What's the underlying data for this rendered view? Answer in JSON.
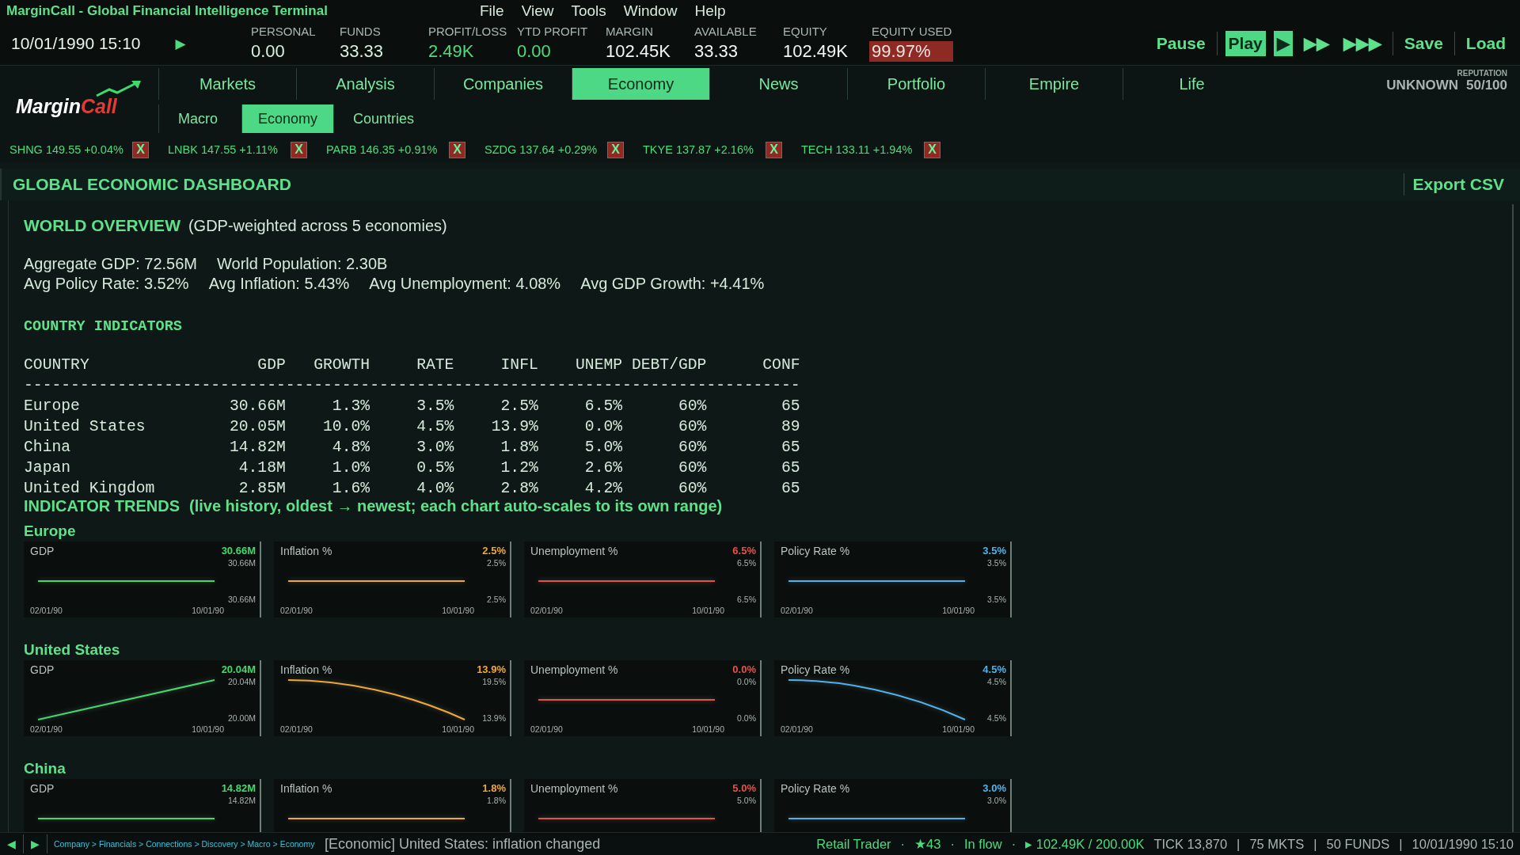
{
  "window": {
    "title": "MarginCall - Global Financial Intelligence Terminal"
  },
  "menu": [
    "File",
    "View",
    "Tools",
    "Window",
    "Help"
  ],
  "toolbar": {
    "datetime": "10/01/1990 15:10",
    "run_button": "▶",
    "stats": [
      {
        "label": "PERSONAL",
        "value": "0.00",
        "kind": "plain",
        "alert": false
      },
      {
        "label": "FUNDS",
        "value": "33.33",
        "kind": "plain",
        "alert": false
      },
      {
        "label": "PROFIT/LOSS",
        "value": "2.49K",
        "kind": "positive",
        "alert": false
      },
      {
        "label": "YTD PROFIT",
        "value": "0.00",
        "kind": "positive",
        "alert": false
      },
      {
        "label": "MARGIN",
        "value": "102.45K",
        "kind": "bright",
        "alert": false
      },
      {
        "label": "AVAILABLE",
        "value": "33.33",
        "kind": "bright",
        "alert": false
      },
      {
        "label": "EQUITY",
        "value": "102.49K",
        "kind": "bright",
        "alert": false
      },
      {
        "label": "EQUITY USED",
        "value": "99.97%",
        "kind": "bright",
        "alert": true
      }
    ],
    "controls": [
      {
        "label": "Pause",
        "selected": false
      },
      {
        "label": "Play",
        "selected": true
      },
      {
        "label": "▶",
        "selected": true
      },
      {
        "label": "▶▶",
        "selected": false
      },
      {
        "label": "▶▶▶",
        "selected": false
      },
      {
        "label": "Save",
        "selected": false
      },
      {
        "label": "Load",
        "selected": false
      }
    ]
  },
  "logo": {
    "text_1": "Margin",
    "text_2": "Call"
  },
  "nav": {
    "tabs": [
      {
        "label": "Markets",
        "selected": false
      },
      {
        "label": "Analysis",
        "selected": false
      },
      {
        "label": "Companies",
        "selected": false
      },
      {
        "label": "Economy",
        "selected": true
      },
      {
        "label": "News",
        "selected": false
      },
      {
        "label": "Portfolio",
        "selected": false
      },
      {
        "label": "Empire",
        "selected": false
      },
      {
        "label": "Life",
        "selected": false
      }
    ],
    "subtabs": [
      {
        "label": "Macro",
        "selected": false
      },
      {
        "label": "Economy",
        "selected": true
      },
      {
        "label": "Countries",
        "selected": false
      }
    ]
  },
  "reputation": {
    "label": "REPUTATION",
    "rank": "UNKNOWN",
    "score": "50/100"
  },
  "tickers": [
    {
      "text": "SHNG 149.55 +0.04%",
      "close": "X"
    },
    {
      "text": "LNBK 147.55 +1.11%",
      "close": "X"
    },
    {
      "text": "PARB 146.35 +0.91%",
      "close": "X"
    },
    {
      "text": "SZDG 137.64 +0.29%",
      "close": "X"
    },
    {
      "text": "TKYE 137.87 +2.16%",
      "close": "X"
    },
    {
      "text": "TECH 133.11 +1.94%",
      "close": "X"
    }
  ],
  "section": {
    "title": "GLOBAL ECONOMIC DASHBOARD",
    "action": "Export CSV"
  },
  "overview": {
    "heading": "WORLD OVERVIEW",
    "note": "(GDP-weighted across 5 economies)",
    "lines": [
      [
        "Aggregate GDP: 72.56M",
        "World Population: 2.30B"
      ],
      [
        "Avg Policy Rate: 3.52%",
        "Avg Inflation: 5.43%",
        "Avg Unemployment: 4.08%",
        "Avg GDP Growth: +4.41%"
      ]
    ]
  },
  "indicators": {
    "heading": "COUNTRY INDICATORS",
    "columns": [
      "COUNTRY",
      "GDP",
      "GROWTH",
      "RATE",
      "INFL",
      "UNEMP",
      "DEBT/GDP",
      "CONF"
    ],
    "rule": "-----------------------------------------------------------------------------------",
    "rows": [
      [
        "Europe",
        "30.66M",
        "1.3%",
        "3.5%",
        "2.5%",
        "6.5%",
        "60%",
        "65"
      ],
      [
        "United States",
        "20.05M",
        "10.0%",
        "4.5%",
        "13.9%",
        "0.0%",
        "60%",
        "89"
      ],
      [
        "China",
        "14.82M",
        "4.8%",
        "3.0%",
        "1.8%",
        "5.0%",
        "60%",
        "65"
      ],
      [
        "Japan",
        "4.18M",
        "1.0%",
        "0.5%",
        "1.2%",
        "2.6%",
        "60%",
        "65"
      ],
      [
        "United Kingdom",
        "2.85M",
        "1.6%",
        "4.0%",
        "2.8%",
        "4.2%",
        "60%",
        "65"
      ]
    ]
  },
  "trends": {
    "heading": "INDICATOR TRENDS",
    "note": "(live history, oldest → newest; each chart auto-scales to its own range)",
    "groups": [
      {
        "name": "Europe",
        "charts": [
          {
            "title": "GDP",
            "current": "30.66M",
            "top_label": "30.66M",
            "bottom_label": "30.66M",
            "start_label": "02/01/90",
            "end_label": "10/01/90",
            "color": "#3ddc6a",
            "kind": "flat"
          },
          {
            "title": "Inflation %",
            "current": "2.5%",
            "top_label": "2.5%",
            "bottom_label": "2.5%",
            "start_label": "02/01/90",
            "end_label": "10/01/90",
            "color": "#f0a830",
            "kind": "flat"
          },
          {
            "title": "Unemployment %",
            "current": "6.5%",
            "top_label": "6.5%",
            "bottom_label": "6.5%",
            "start_label": "02/01/90",
            "end_label": "10/01/90",
            "color": "#e8504a",
            "kind": "flat"
          },
          {
            "title": "Policy Rate %",
            "current": "3.5%",
            "top_label": "3.5%",
            "bottom_label": "3.5%",
            "start_label": "02/01/90",
            "end_label": "10/01/90",
            "color": "#4ab4f0",
            "kind": "flat"
          }
        ]
      },
      {
        "name": "United States",
        "charts": [
          {
            "title": "GDP",
            "current": "20.04M",
            "top_label": "20.04M",
            "bottom_label": "20.00M",
            "start_label": "02/01/90",
            "end_label": "10/01/90",
            "color": "#3ddc6a",
            "kind": "rising"
          },
          {
            "title": "Inflation %",
            "current": "13.9%",
            "top_label": "19.5%",
            "bottom_label": "13.9%",
            "start_label": "02/01/90",
            "end_label": "10/01/90",
            "color": "#f0a830",
            "kind": "falling"
          },
          {
            "title": "Unemployment %",
            "current": "0.0%",
            "top_label": "0.0%",
            "bottom_label": "0.0%",
            "start_label": "02/01/90",
            "end_label": "10/01/90",
            "color": "#e8504a",
            "kind": "flat"
          },
          {
            "title": "Policy Rate %",
            "current": "4.5%",
            "top_label": "4.5%",
            "bottom_label": "4.5%",
            "start_label": "02/01/90",
            "end_label": "10/01/90",
            "color": "#4ab4f0",
            "kind": "falling"
          }
        ]
      },
      {
        "name": "China",
        "charts": [
          {
            "title": "GDP",
            "current": "14.82M",
            "top_label": "14.82M",
            "color": "#3ddc6a",
            "kind": "flat"
          },
          {
            "title": "Inflation %",
            "current": "1.8%",
            "top_label": "1.8%",
            "color": "#f0a830",
            "kind": "flat"
          },
          {
            "title": "Unemployment %",
            "current": "5.0%",
            "top_label": "5.0%",
            "color": "#e8504a",
            "kind": "flat"
          },
          {
            "title": "Policy Rate %",
            "current": "3.0%",
            "top_label": "3.0%",
            "color": "#4ab4f0",
            "kind": "flat"
          }
        ]
      }
    ]
  },
  "status_bar": {
    "nav": [
      "◀",
      "▶"
    ],
    "breadcrumb": "Company > Financials > Connections > Discovery > Macro > Economy",
    "message": "[Economic] United States: inflation changed",
    "right": [
      {
        "text": "Retail Trader",
        "kind": "accent"
      },
      {
        "text": "·",
        "kind": "accent"
      },
      {
        "text": "★43",
        "kind": "accent"
      },
      {
        "text": "·",
        "kind": "accent"
      },
      {
        "text": "In flow",
        "kind": "accent"
      },
      {
        "text": "·",
        "kind": "accent"
      },
      {
        "text": "▸ 102.49K / 200.00K",
        "kind": "accent"
      },
      {
        "text": "TICK 13,870",
        "kind": "muted"
      },
      {
        "text": "|",
        "kind": "muted"
      },
      {
        "text": "75 MKTS",
        "kind": "muted"
      },
      {
        "text": "|",
        "kind": "muted"
      },
      {
        "text": "50 FUNDS",
        "kind": "muted"
      },
      {
        "text": "|",
        "kind": "muted"
      },
      {
        "text": "10/01/1990 15:10",
        "kind": "muted"
      }
    ]
  }
}
